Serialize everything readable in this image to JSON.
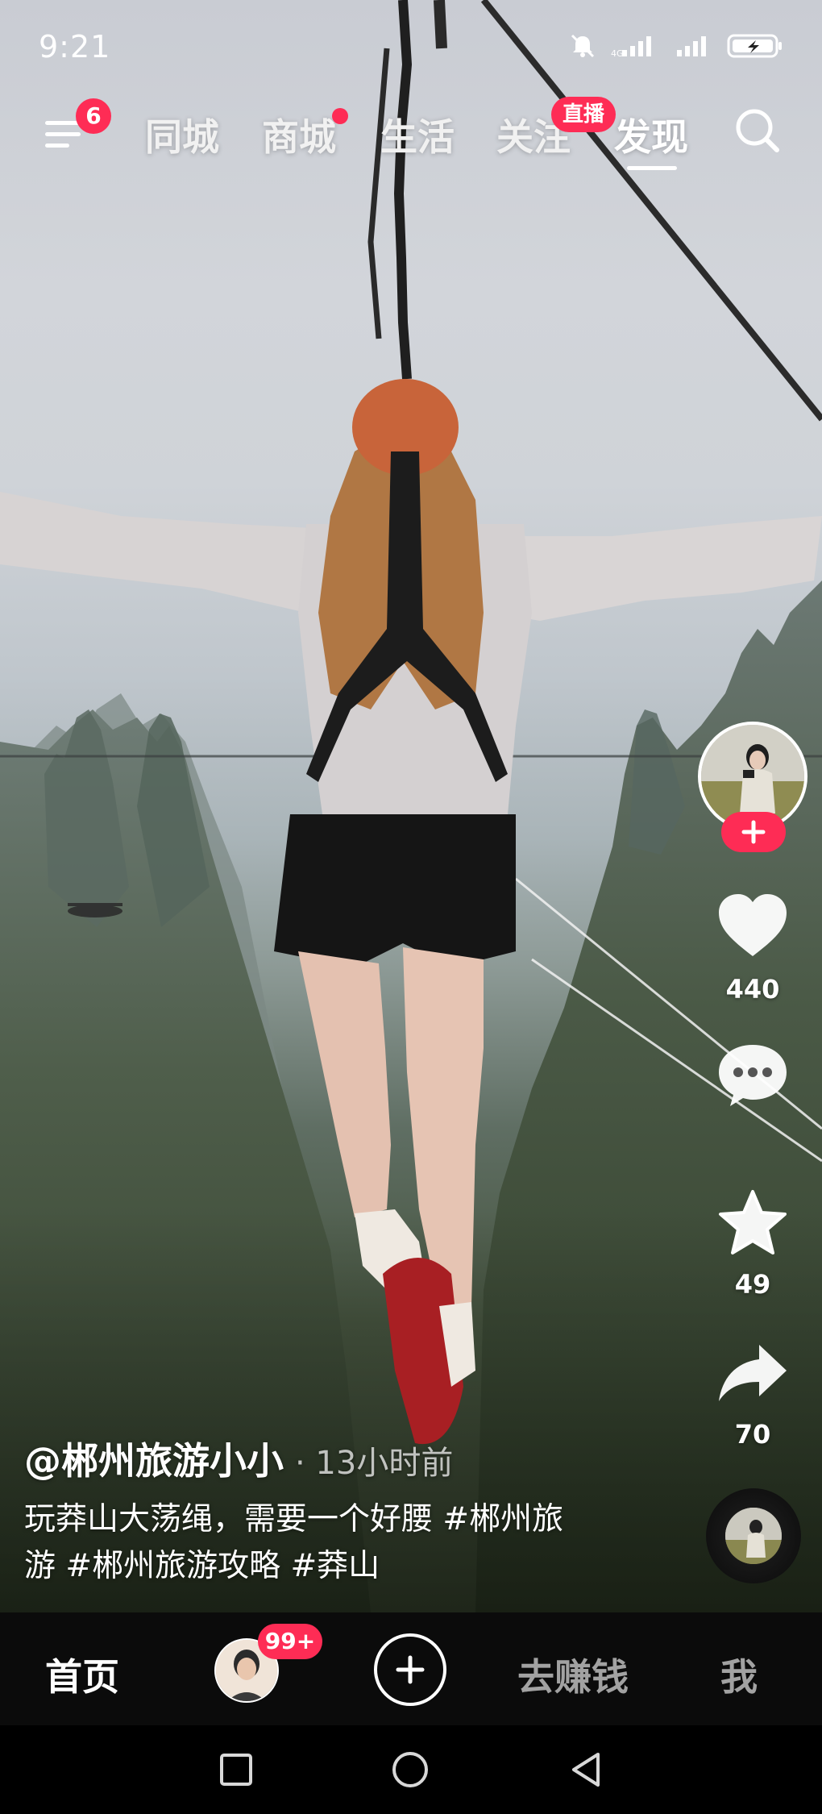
{
  "status_bar": {
    "time": "9:21",
    "icons": [
      "mute-bell-icon",
      "signal-4g-icon",
      "signal-icon",
      "battery-charging-icon"
    ]
  },
  "top_nav": {
    "menu_badge": "6",
    "tabs": [
      {
        "label": "同城"
      },
      {
        "label": "商城",
        "has_dot": true
      },
      {
        "label": "生活"
      },
      {
        "label": "关注",
        "badge": "直播"
      },
      {
        "label": "发现",
        "active": true
      }
    ],
    "icons": [
      "menu-icon",
      "search-icon"
    ]
  },
  "actions": {
    "like_count": "440",
    "comment_count": "",
    "favorite_count": "49",
    "share_count": "70",
    "icons": [
      "follow-plus-icon",
      "heart-icon",
      "comment-icon",
      "star-icon",
      "share-icon",
      "music-disc-icon"
    ]
  },
  "post": {
    "author": "@郴州旅游小小",
    "meta": "· 13小时前",
    "caption": "玩莽山大荡绳，需要一个好腰 #郴州旅游 #郴州旅游攻略 #莽山"
  },
  "bottom_tabs": {
    "home": "首页",
    "friends_badge": "99+",
    "earn": "去赚钱",
    "me": "我",
    "icons": [
      "create-plus-icon"
    ]
  },
  "system_nav": {
    "icons": [
      "recent-apps-icon",
      "home-icon",
      "back-icon"
    ]
  },
  "colors": {
    "accent": "#fe2c55",
    "tab_bar_bg": "#0b0b0b"
  }
}
